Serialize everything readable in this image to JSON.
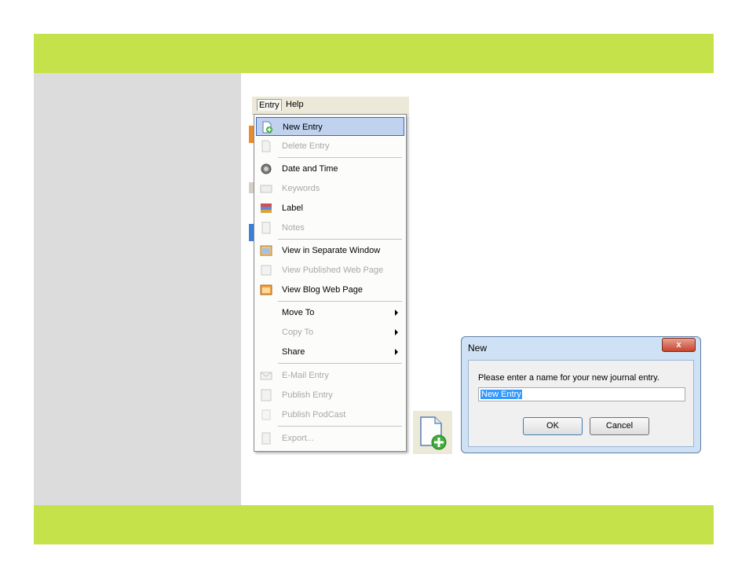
{
  "menubar": {
    "entry": "Entry",
    "help": "Help"
  },
  "menu": {
    "items": [
      {
        "label": "New Entry",
        "icon": "new-entry-icon",
        "disabled": false
      },
      {
        "label": "Delete Entry",
        "icon": "delete-entry-icon",
        "disabled": true
      },
      {
        "label": "Date and Time",
        "icon": "clock-icon",
        "disabled": false
      },
      {
        "label": "Keywords",
        "icon": "keywords-icon",
        "disabled": true
      },
      {
        "label": "Label",
        "icon": "label-icon",
        "disabled": false
      },
      {
        "label": "Notes",
        "icon": "notes-icon",
        "disabled": true
      },
      {
        "label": "View in Separate Window",
        "icon": "window-icon",
        "disabled": false
      },
      {
        "label": "View Published Web Page",
        "icon": "published-page-icon",
        "disabled": true
      },
      {
        "label": "View Blog Web Page",
        "icon": "blog-page-icon",
        "disabled": false
      },
      {
        "label": "Move To",
        "disabled": false,
        "submenu": true
      },
      {
        "label": "Copy To",
        "disabled": true,
        "submenu": true
      },
      {
        "label": "Share",
        "disabled": false,
        "submenu": true
      },
      {
        "label": "E-Mail Entry",
        "icon": "email-icon",
        "disabled": true
      },
      {
        "label": "Publish Entry",
        "icon": "publish-icon",
        "disabled": true
      },
      {
        "label": "Publish PodCast",
        "icon": "podcast-icon",
        "disabled": true
      },
      {
        "label": "Export...",
        "icon": "export-icon",
        "disabled": true
      }
    ]
  },
  "dialog": {
    "title": "New",
    "close": "x",
    "prompt": "Please enter a name for your new journal entry.",
    "input_value": "New Entry",
    "ok": "OK",
    "cancel": "Cancel"
  },
  "colors": {
    "band": "#c5e24a",
    "panel": "#dcdcdc",
    "highlight": "#c1d2ee"
  }
}
